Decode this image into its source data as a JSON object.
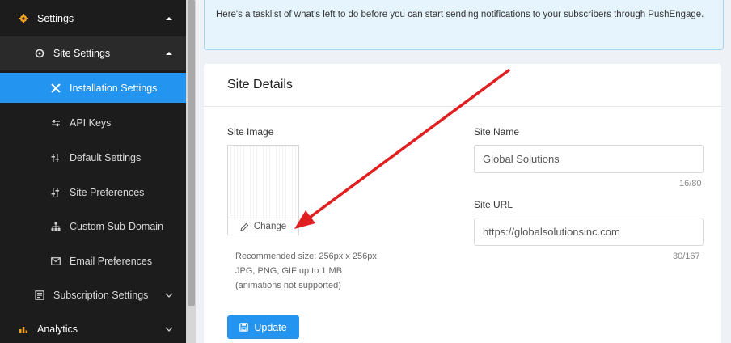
{
  "sidebar": {
    "settings": {
      "label": "Settings",
      "icon": "gear-icon"
    },
    "site_settings": {
      "label": "Site Settings",
      "icon": "gear-icon"
    },
    "items": [
      {
        "label": "Installation Settings",
        "icon": "tools-icon",
        "active": true
      },
      {
        "label": "API Keys",
        "icon": "key-icon"
      },
      {
        "label": "Default Settings",
        "icon": "sliders-icon"
      },
      {
        "label": "Site Preferences",
        "icon": "sliders-icon"
      },
      {
        "label": "Custom Sub-Domain",
        "icon": "sitemap-icon"
      },
      {
        "label": "Email Preferences",
        "icon": "envelope-icon"
      }
    ],
    "subscription_settings": {
      "label": "Subscription Settings",
      "icon": "list-icon"
    },
    "analytics": {
      "label": "Analytics",
      "icon": "chart-icon"
    }
  },
  "notice": {
    "text": "Here's a tasklist of what's left to do before you can start sending notifications to your subscribers through PushEngage."
  },
  "site_details": {
    "title": "Site Details",
    "site_image_label": "Site Image",
    "change_label": "Change",
    "recommendation": [
      "Recommended size: 256px x 256px",
      "JPG, PNG, GIF up to 1 MB",
      "(animations not supported)"
    ],
    "site_name_label": "Site Name",
    "site_name_value": "Global Solutions",
    "site_name_counter": "16/80",
    "site_url_label": "Site URL",
    "site_url_value": "https://globalsolutionsinc.com",
    "site_url_counter": "30/167",
    "update_label": "Update"
  },
  "colors": {
    "sidebar_bg": "#1c1c1c",
    "accent": "#2394f0",
    "annotation_arrow": "#e02020"
  }
}
